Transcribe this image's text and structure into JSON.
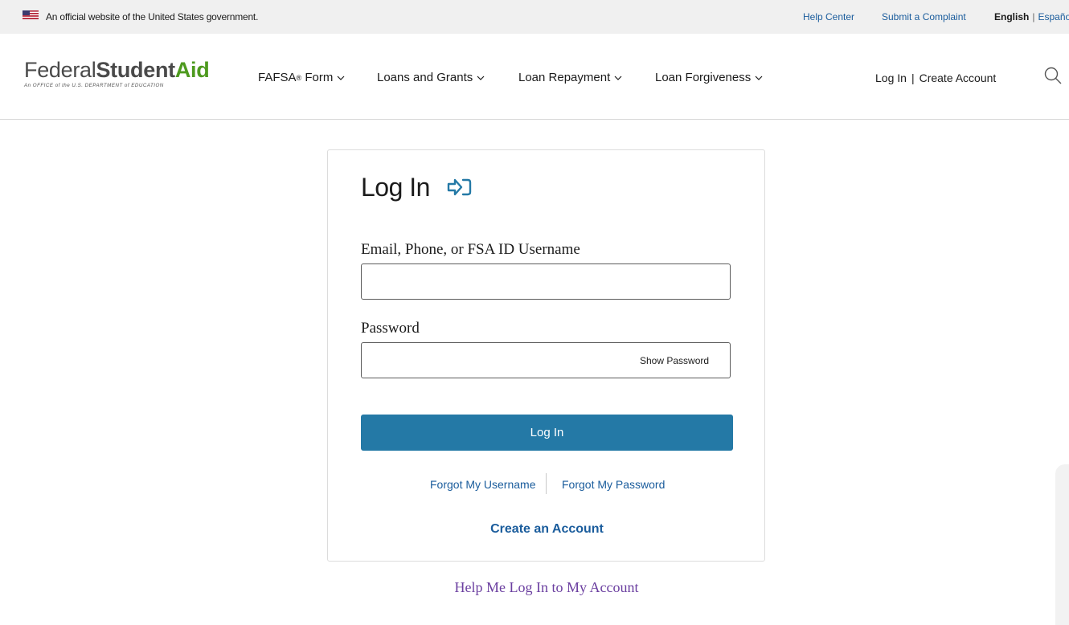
{
  "banner": {
    "official_text": "An official website of the United States government.",
    "help_center": "Help Center",
    "submit_complaint": "Submit a Complaint",
    "lang_english": "English",
    "lang_separator": "|",
    "lang_spanish": "Español"
  },
  "header": {
    "logo_federal": "Federal",
    "logo_student": "Student",
    "logo_aid": "Aid",
    "logo_tagline": "An OFFICE of the U.S. DEPARTMENT of EDUCATION",
    "nav": {
      "fafsa": "FAFSA",
      "fafsa_reg": "®",
      "fafsa_suffix": " Form",
      "loans": "Loans and Grants",
      "repayment": "Loan Repayment",
      "forgiveness": "Loan Forgiveness"
    },
    "login": "Log In",
    "account_separator": "|",
    "create_account": "Create Account"
  },
  "card": {
    "title": "Log In",
    "username_label": "Email, Phone, or FSA ID Username",
    "username_value": "",
    "password_label": "Password",
    "password_value": "",
    "show_password": "Show Password",
    "login_button": "Log In",
    "forgot_username": "Forgot My Username",
    "forgot_password": "Forgot My Password",
    "create_account": "Create an Account"
  },
  "help_link": "Help Me Log In to My Account",
  "colors": {
    "primary_button": "#2479a6",
    "link": "#1a5c9c",
    "logo_green": "#4e9a1f",
    "help_link": "#6b3fa0",
    "banner_bg": "#f0f0f0"
  }
}
